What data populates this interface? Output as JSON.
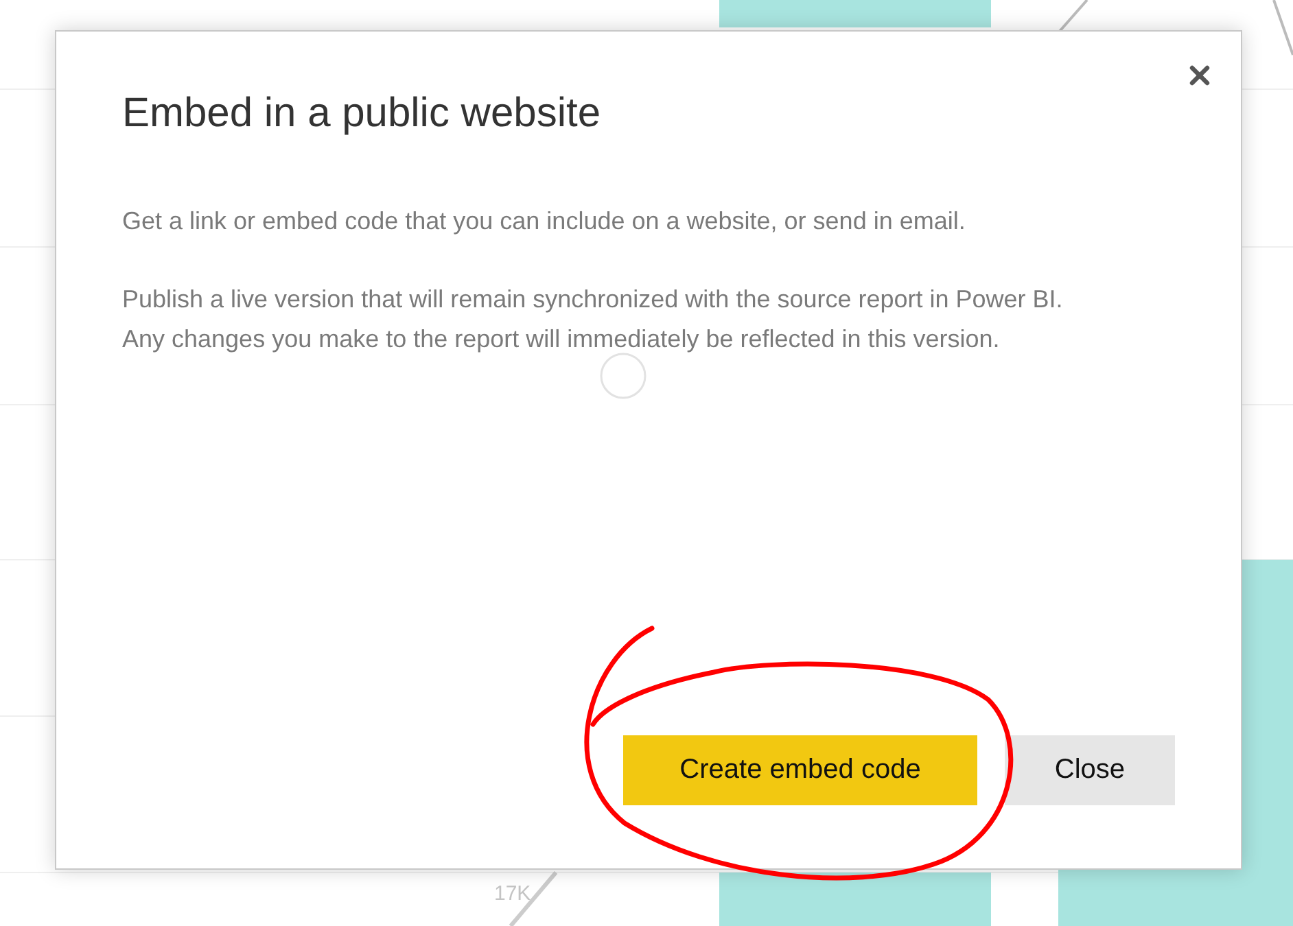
{
  "background": {
    "axis_label": "17K"
  },
  "dialog": {
    "title": "Embed in a public website",
    "paragraphs": [
      "Get a link or embed code that you can include on a website, or send in email.",
      "Publish a live version that will remain synchronized with the source report in Power BI. Any changes you make to the report will immediately be reflected in this version."
    ],
    "loading": true,
    "buttons": [
      {
        "label": "Create embed code",
        "kind": "primary"
      },
      {
        "label": "Close",
        "kind": "secondary"
      }
    ]
  }
}
